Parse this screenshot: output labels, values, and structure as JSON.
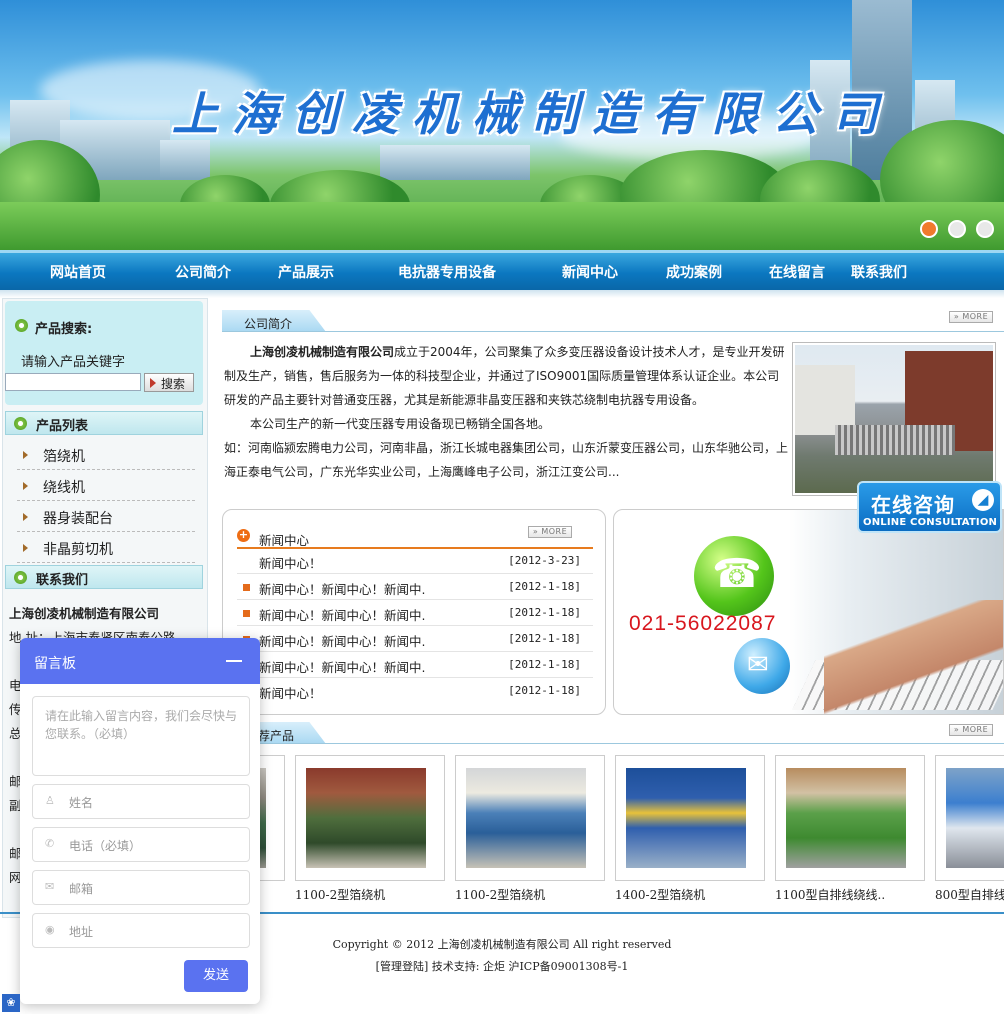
{
  "banner": {
    "title": "上海创凌机械制造有限公司",
    "slides": 3,
    "active_slide": 1
  },
  "nav": [
    "网站首页",
    "公司简介",
    "产品展示",
    "电抗器专用设备",
    "新闻中心",
    "成功案例",
    "在线留言",
    "联系我们"
  ],
  "sidebar": {
    "search_title": "产品搜索:",
    "search_hint": "请输入产品关键字",
    "search_button": "搜索",
    "categories_title": "产品列表",
    "categories": [
      "箔绕机",
      "绕线机",
      "器身装配台",
      "非晶剪切机"
    ],
    "contact_title": "联系我们",
    "company": "上海创凌机械制造有限公司",
    "address": "地  址：上海市奉贤区南奉公路",
    "contact_fragments": [
      "电",
      "传",
      "总",
      "邮",
      "副",
      "邮",
      "网"
    ]
  },
  "about": {
    "tab": "公司简介",
    "more": "» MORE",
    "p1_bold": "上海创凌机械制造有限公司",
    "p1_rest": "成立于2004年，公司聚集了众多变压器设备设计技术人才，是专业开发研制及生产，销售，售后服务为一体的科技型企业，并通过了ISO9001国际质量管理体系认证企业。本公司研发的产品主要针对普通变压器，尤其是新能源非晶变压器和夹铁芯绕制电抗器专用设备。",
    "p2": "本公司生产的新一代变压器专用设备现已畅销全国各地。",
    "p3": "如：河南临颍宏腾电力公司，河南非晶，浙江长城电器集团公司，山东沂蒙变压器公司，山东华驰公司，上海正泰电气公司，广东光华实业公司，上海鹰峰电子公司，浙江江变公司..."
  },
  "news": {
    "title": "新闻中心",
    "more": "» MORE",
    "items": [
      {
        "title": "新闻中心！",
        "date": "[2012-3-23]"
      },
      {
        "title": "新闻中心！新闻中心！新闻中.",
        "date": "[2012-1-18]"
      },
      {
        "title": "新闻中心！新闻中心！新闻中.",
        "date": "[2012-1-18]"
      },
      {
        "title": "新闻中心！新闻中心！新闻中.",
        "date": "[2012-1-18]"
      },
      {
        "title": "新闻中心！新闻中心！新闻中.",
        "date": "[2012-1-18]"
      },
      {
        "title": "新闻中心！",
        "date": "[2012-1-18]"
      }
    ]
  },
  "promo": {
    "phone": "021-56022087"
  },
  "consult": {
    "title": "在线咨询",
    "subtitle": "ONLINE CONSULTATION"
  },
  "products": {
    "tab": "荐产品",
    "more": "» MORE",
    "items": [
      {
        "name": "1100-2型箔绕机",
        "color": "#3f6b4a"
      },
      {
        "name": "1100-2型箔绕机",
        "color": "#4b80b8"
      },
      {
        "name": "1400-2型箔绕机",
        "color": "#2f5fae"
      },
      {
        "name": "1100型自排线绕线..",
        "color": "#5ba04a"
      },
      {
        "name": "800型自排线",
        "color": "#3c7fcf"
      }
    ]
  },
  "footer": {
    "line1": "Copyright © 2012   上海创凌机械制造有限公司 All right reserved",
    "line2": "[管理登陆]  技术支持: 企炬 沪ICP备09001308号-1"
  },
  "message_board": {
    "title": "留言板",
    "content_placeholder": "请在此输入留言内容，我们会尽快与您联系。（必填）",
    "name_placeholder": "姓名",
    "phone_placeholder": "电话（必填）",
    "email_placeholder": "邮箱",
    "address_placeholder": "地址",
    "send": "发送"
  }
}
